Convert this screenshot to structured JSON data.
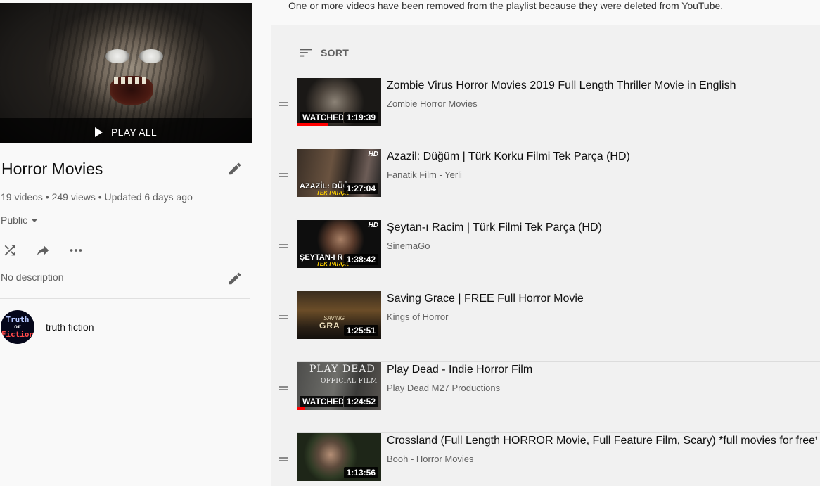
{
  "notice": "One or more videos have been removed from the playlist because they were deleted from YouTube.",
  "sidebar": {
    "play_all_label": "PLAY ALL",
    "title": "Horror Movies",
    "stats": "19 videos • 249 views • Updated 6 days ago",
    "privacy": "Public",
    "description": "No description",
    "owner": {
      "name": "truth fiction",
      "avatar_line1": "Truth",
      "avatar_line2": "or",
      "avatar_line3": "Fiction"
    }
  },
  "list": {
    "sort_label": "SORT",
    "videos": [
      {
        "title": "Zombie Virus Horror Movies 2019 Full Length Thriller Movie in English",
        "channel": "Zombie Horror Movies",
        "duration": "1:19:39",
        "watched_label": "WATCHED",
        "progress": 0.37
      },
      {
        "title": "Azazil: Düğüm | Türk Korku Filmi Tek Parça (HD)",
        "channel": "Fanatik Film - Yerli",
        "duration": "1:27:04",
        "thumb_title": "AZAZİL: DÜĞ",
        "thumb_sub": "TEK PARÇA",
        "hd": "HD"
      },
      {
        "title": "Şeytan-ı Racim | Türk Filmi Tek Parça (HD)",
        "channel": "SinemaGo",
        "duration": "1:38:42",
        "thumb_title": "ŞEYTAN-I R",
        "thumb_sub": "TEK PARÇA",
        "hd": "HD"
      },
      {
        "title": "Saving Grace | FREE Full Horror Movie",
        "channel": "Kings of Horror",
        "duration": "1:25:51",
        "thumb_small": "SAVING",
        "thumb_big": "GRA"
      },
      {
        "title": "Play Dead - Indie Horror Film",
        "channel": "Play Dead M27 Productions",
        "duration": "1:24:52",
        "watched_label": "WATCHED",
        "progress": 0.1,
        "thumb_big": "PLAY DEAD",
        "thumb_small": "OFFICIAL FILM"
      },
      {
        "title": "Crossland (Full Length HORROR Movie, Full Feature Film, Scary) *full movies for free*",
        "channel": "Booh - Horror Movies",
        "duration": "1:13:56"
      }
    ]
  }
}
